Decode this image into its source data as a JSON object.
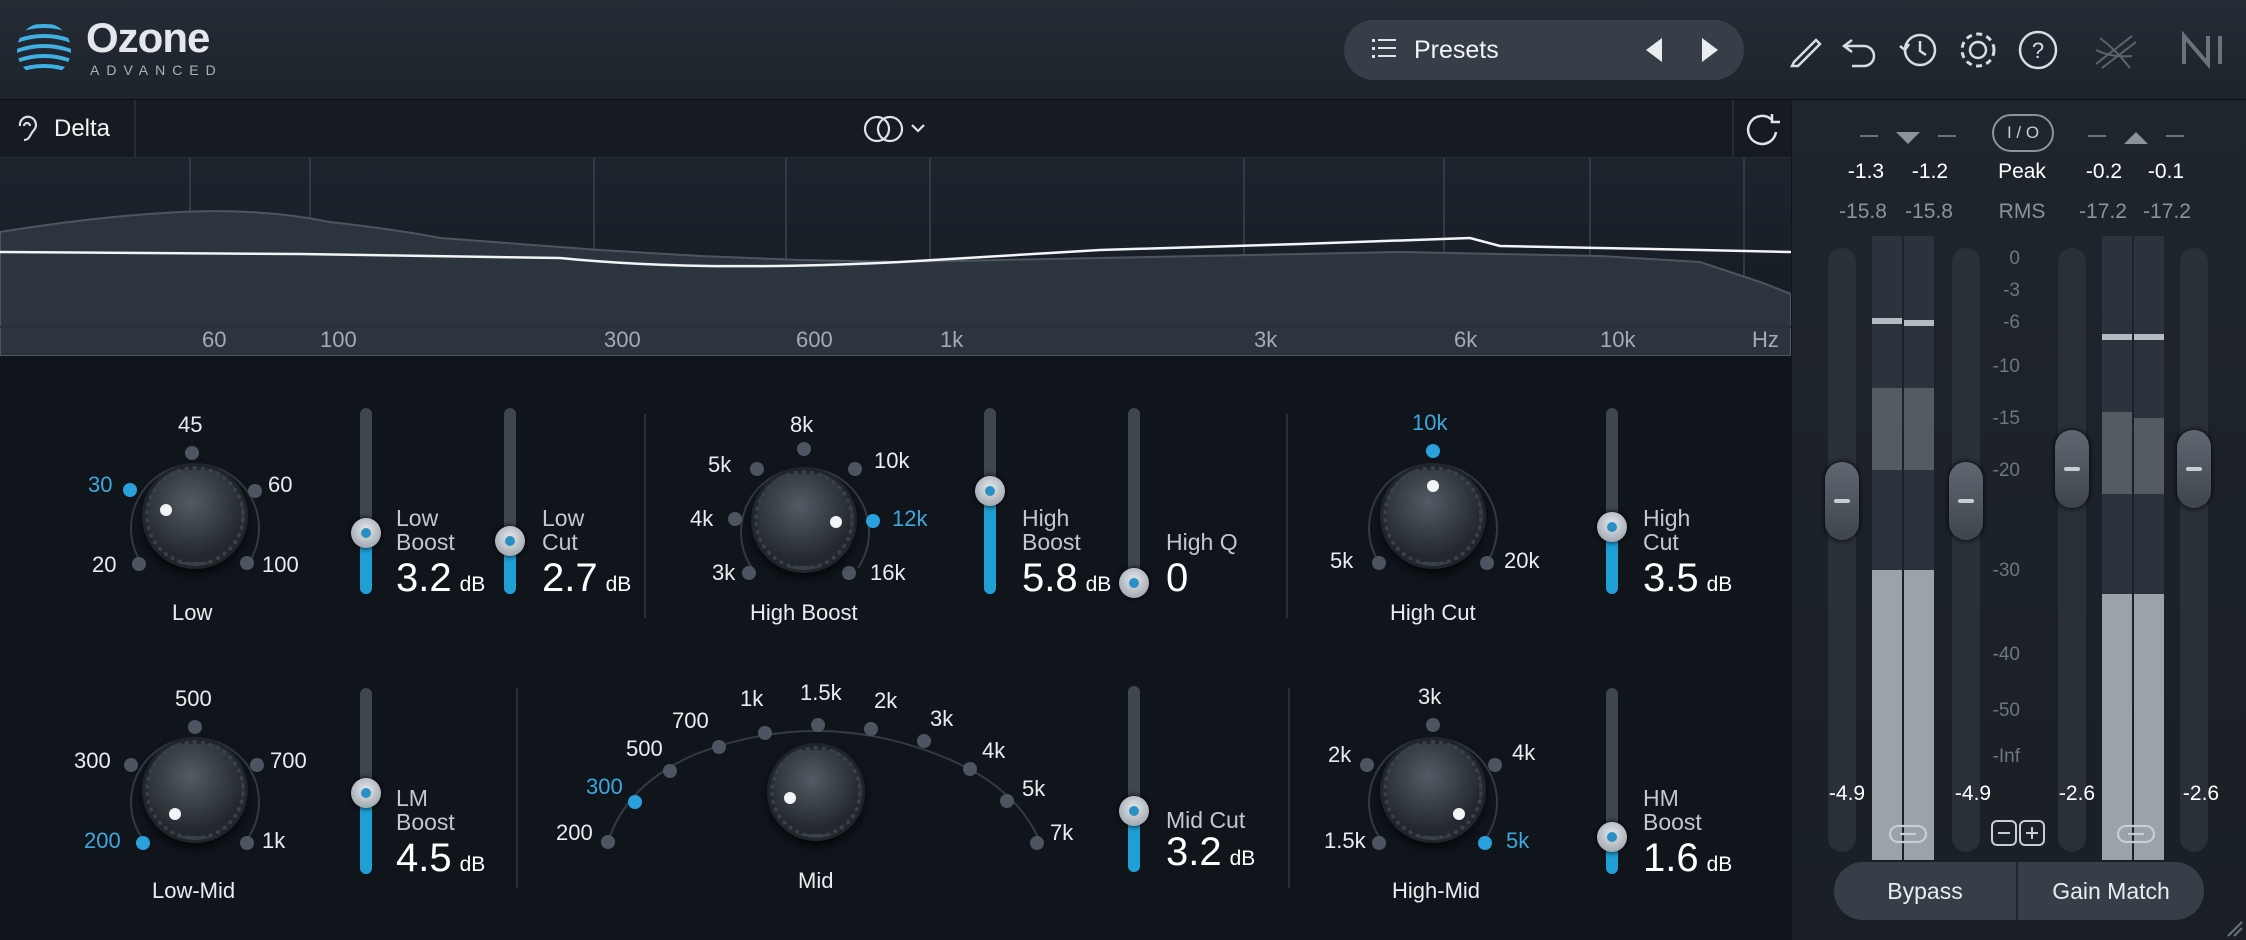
{
  "app": {
    "brand": "Ozone",
    "edition": "ADVANCED"
  },
  "header": {
    "presets_label": "Presets"
  },
  "toolbar": {
    "delta_label": "Delta"
  },
  "spectrum": {
    "freq_labels": [
      "60",
      "100",
      "300",
      "600",
      "1k",
      "3k",
      "6k",
      "10k",
      "Hz"
    ]
  },
  "low": {
    "title": "Low",
    "positions": [
      "20",
      "30",
      "45",
      "60",
      "100"
    ],
    "selected": "30"
  },
  "low_boost": {
    "label_1": "Low",
    "label_2": "Boost",
    "value": "3.2",
    "unit": "dB",
    "level": 0.35
  },
  "low_cut": {
    "label_1": "Low",
    "label_2": "Cut",
    "value": "2.7",
    "unit": "dB",
    "level": 0.28
  },
  "high_boost": {
    "title": "High Boost",
    "positions": [
      "3k",
      "4k",
      "5k",
      "8k",
      "10k",
      "12k",
      "16k"
    ],
    "selected": "12k"
  },
  "high_boost_gain": {
    "label_1": "High",
    "label_2": "Boost",
    "value": "5.8",
    "unit": "dB",
    "level": 0.58
  },
  "high_q": {
    "label": "High Q",
    "value": "0",
    "level": 0.0
  },
  "high_cut": {
    "title": "High Cut",
    "positions": [
      "5k",
      "10k",
      "20k"
    ],
    "selected": "10k"
  },
  "high_cut_gain": {
    "label_1": "High",
    "label_2": "Cut",
    "value": "3.5",
    "unit": "dB",
    "level": 0.38
  },
  "low_mid": {
    "title": "Low-Mid",
    "positions": [
      "200",
      "300",
      "500",
      "700",
      "1k"
    ],
    "selected": "200"
  },
  "lm_boost": {
    "label_1": "LM",
    "label_2": "Boost",
    "value": "4.5",
    "unit": "dB",
    "level": 0.45
  },
  "mid": {
    "title": "Mid",
    "positions": [
      "200",
      "300",
      "500",
      "700",
      "1k",
      "1.5k",
      "2k",
      "3k",
      "4k",
      "5k",
      "7k"
    ],
    "selected": "300"
  },
  "mid_cut": {
    "label": "Mid Cut",
    "value": "3.2",
    "unit": "dB",
    "level": 0.32
  },
  "high_mid": {
    "title": "High-Mid",
    "positions": [
      "1.5k",
      "2k",
      "3k",
      "4k",
      "5k"
    ],
    "selected": "5k"
  },
  "hm_boost": {
    "label_1": "HM",
    "label_2": "Boost",
    "value": "1.6",
    "unit": "dB",
    "level": 0.16
  },
  "meters": {
    "io_label": "I / O",
    "peak_label": "Peak",
    "rms_label": "RMS",
    "input_peak": [
      "-1.3",
      "-1.2"
    ],
    "input_rms": [
      "-15.8",
      "-15.8"
    ],
    "output_peak": [
      "-0.2",
      "-0.1"
    ],
    "output_rms": [
      "-17.2",
      "-17.2"
    ],
    "scale": [
      "0",
      "-3",
      "-6",
      "-10",
      "-15",
      "-20",
      "-30",
      "-40",
      "-50",
      "-Inf"
    ],
    "input_gain": [
      "-4.9",
      "-4.9"
    ],
    "output_gain": [
      "-2.6",
      "-2.6"
    ]
  },
  "footer": {
    "bypass_label": "Bypass",
    "gain_match_label": "Gain Match"
  },
  "colors": {
    "accent": "#2aa0dc",
    "background": "#10151c"
  }
}
